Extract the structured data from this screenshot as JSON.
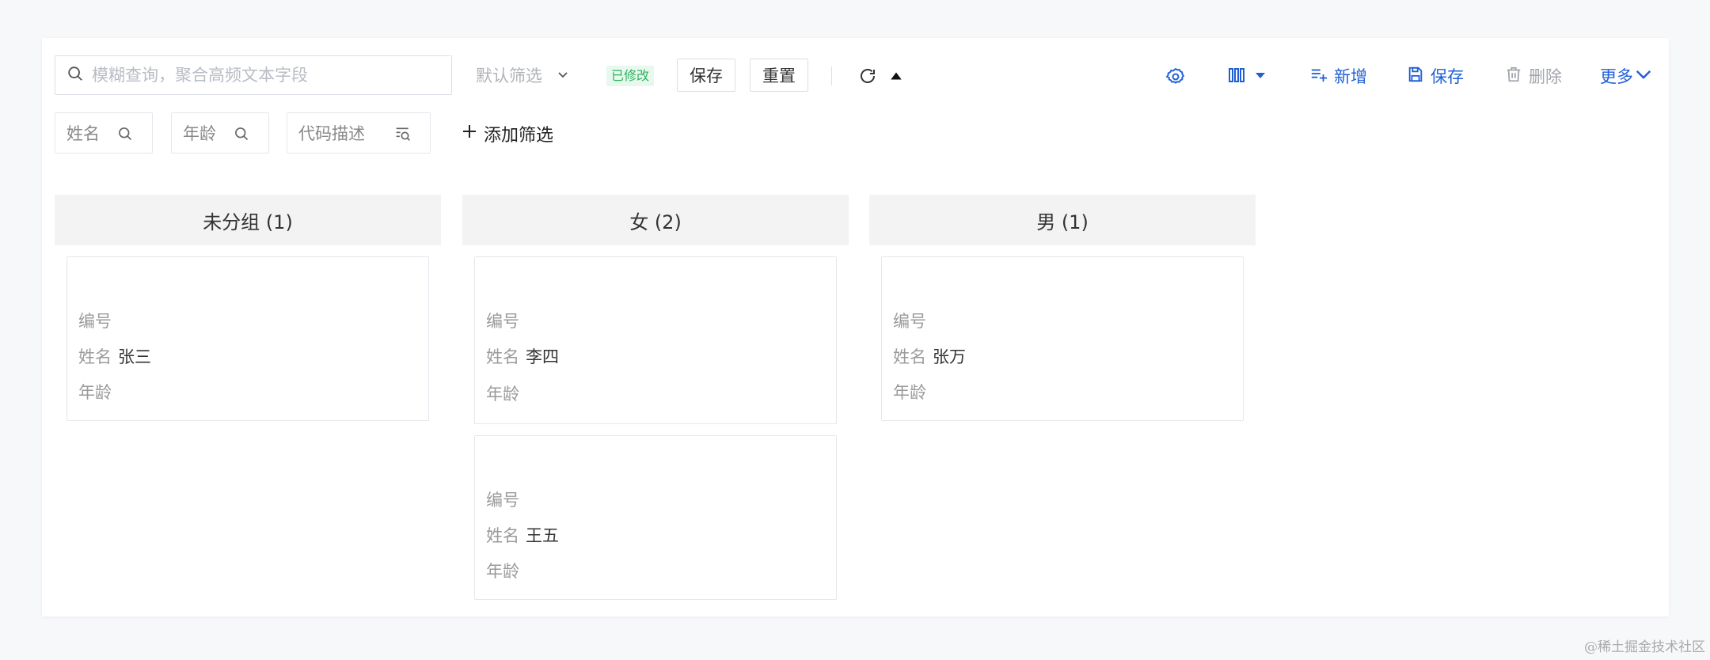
{
  "toolbar": {
    "search_placeholder": "模糊查询，聚合高频文本字段",
    "filter_select_label": "默认筛选",
    "modified_tag": "已修改",
    "save_filter_label": "保存",
    "reset_label": "重置",
    "actions": {
      "add_label": "新增",
      "save_label": "保存",
      "delete_label": "删除",
      "more_label": "更多"
    },
    "accent_color": "#1f5fd6"
  },
  "filters": {
    "chips": [
      "姓名",
      "年龄",
      "代码描述"
    ],
    "add_filter_label": "添加筛选"
  },
  "board": {
    "columns": [
      {
        "title": "未分组 (1)",
        "cards": [
          {
            "id_label": "编号",
            "name_label": "姓名",
            "name_value": "张三",
            "age_label": "年龄"
          }
        ]
      },
      {
        "title": "女 (2)",
        "cards": [
          {
            "id_label": "编号",
            "name_label": "姓名",
            "name_value": "李四",
            "age_label": "年龄"
          },
          {
            "id_label": "编号",
            "name_label": "姓名",
            "name_value": "王五",
            "age_label": "年龄"
          }
        ]
      },
      {
        "title": "男 (1)",
        "cards": [
          {
            "id_label": "编号",
            "name_label": "姓名",
            "name_value": "张万",
            "age_label": "年龄"
          }
        ]
      }
    ]
  },
  "watermark": "@稀土掘金技术社区"
}
